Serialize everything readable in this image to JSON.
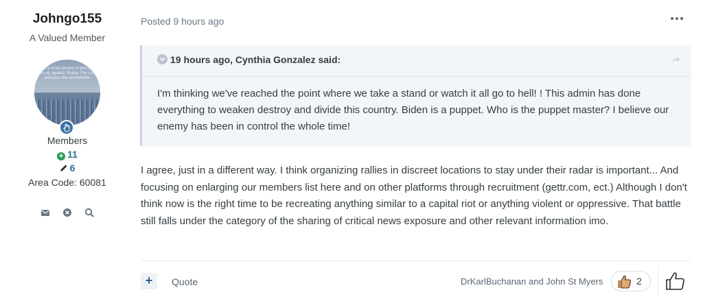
{
  "author": {
    "name": "Johngo155",
    "rank": "A Valued Member",
    "avatar_text": "Just a small picture of who they are up against. Praise The Lord and pass the ammunition",
    "group": "Members",
    "reputation": "11",
    "posts": "6",
    "area_code": "Area Code: 60081",
    "icons": [
      "envelope-icon",
      "close-circle-icon",
      "search-icon"
    ]
  },
  "post": {
    "posted": "Posted 9 hours ago",
    "quote": {
      "header": "19 hours ago, Cynthia Gonzalez said:",
      "body": "I'm thinking we've reached the point where we take a stand or watch it all go to hell! ! This admin has done everything to weaken  destroy and divide this country. Biden is a puppet. Who is the puppet master? I believe our enemy has been in control the whole time!"
    },
    "body": "I agree, just in a different way. I think organizing rallies in discreet locations to stay under their radar is important... And focusing on enlarging our members list here and on other platforms through recruitment (gettr.com, ect.) Although I don't think now is the right time to be recreating anything similar to a capital riot or anything violent or oppressive. That battle still falls under the category of the sharing of critical news exposure and other relevant information imo."
  },
  "footer": {
    "multiquote_label": "+",
    "quote_label": "Quote",
    "likers": "DrKarlBuchanan and John St Myers",
    "like_count": "2"
  },
  "colors": {
    "accent": "#2f6e91",
    "reputation_green": "#2d9a5c",
    "quote_bg": "#f3f6f9"
  }
}
